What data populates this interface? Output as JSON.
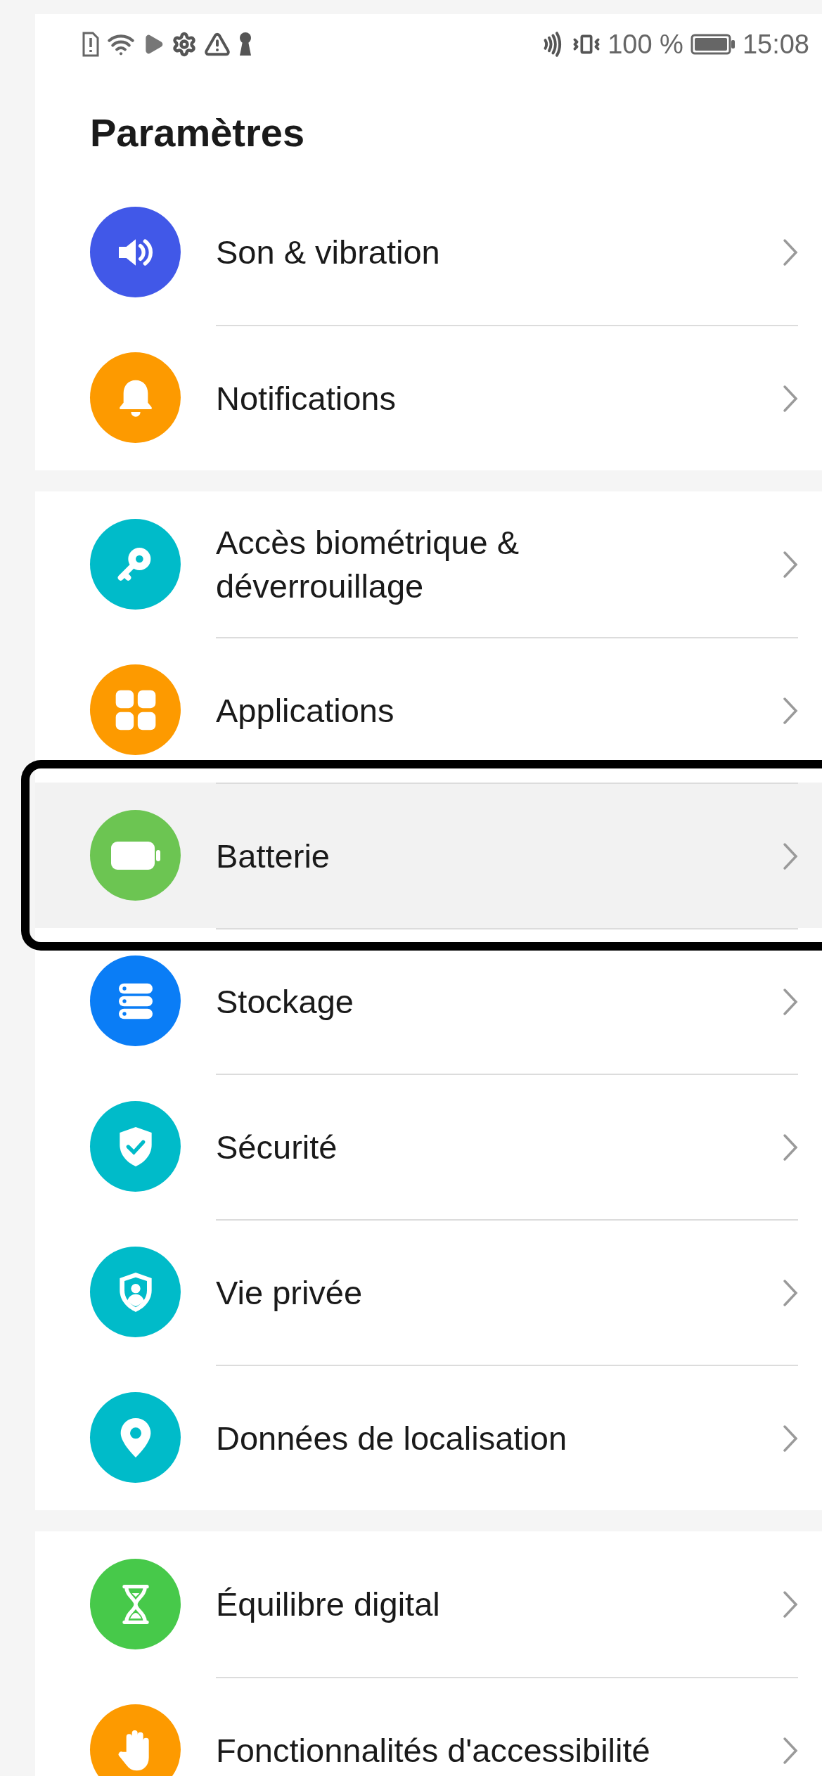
{
  "status_bar": {
    "battery": "100 %",
    "time": "15:08"
  },
  "title": "Paramètres",
  "groups": [
    {
      "items": [
        {
          "label": "Son & vibration",
          "color": "#4158e8",
          "selected": false,
          "outlined": false
        },
        {
          "label": "Notifications",
          "color": "#fd9a00",
          "selected": false,
          "outlined": false
        }
      ]
    },
    {
      "items": [
        {
          "label": "Accès biométrique & déverrouillage",
          "color": "#00bbc9",
          "selected": false,
          "outlined": false
        },
        {
          "label": "Applications",
          "color": "#fd9a00",
          "selected": false,
          "outlined": false
        },
        {
          "label": "Batterie",
          "color": "#6cc552",
          "selected": true,
          "outlined": true
        },
        {
          "label": "Stockage",
          "color": "#0a7df6",
          "selected": false,
          "outlined": false
        },
        {
          "label": "Sécurité",
          "color": "#00bbc9",
          "selected": false,
          "outlined": false
        },
        {
          "label": "Vie privée",
          "color": "#00bbc9",
          "selected": false,
          "outlined": false
        },
        {
          "label": "Données de localisation",
          "color": "#00bbc9",
          "selected": false,
          "outlined": false
        }
      ]
    },
    {
      "items": [
        {
          "label": "Équilibre digital",
          "color": "#47c94a",
          "selected": false,
          "outlined": false
        },
        {
          "label": "Fonctionnalités d'accessibilité",
          "color": "#fd9a00",
          "selected": false,
          "outlined": false
        }
      ]
    }
  ]
}
